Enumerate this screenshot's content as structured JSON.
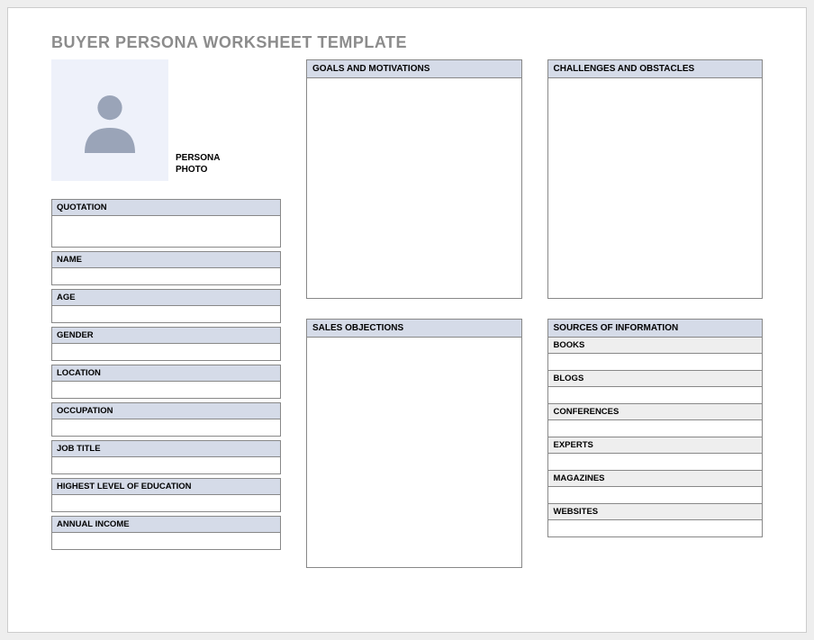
{
  "title": "BUYER PERSONA WORKSHEET TEMPLATE",
  "photo_label": "PERSONA PHOTO",
  "left_fields": [
    {
      "label": "QUOTATION",
      "value": ""
    },
    {
      "label": "NAME",
      "value": ""
    },
    {
      "label": "AGE",
      "value": ""
    },
    {
      "label": "GENDER",
      "value": ""
    },
    {
      "label": "LOCATION",
      "value": ""
    },
    {
      "label": "OCCUPATION",
      "value": ""
    },
    {
      "label": "JOB TITLE",
      "value": ""
    },
    {
      "label": "HIGHEST LEVEL OF EDUCATION",
      "value": ""
    },
    {
      "label": "ANNUAL INCOME",
      "value": ""
    }
  ],
  "panels": {
    "goals": {
      "label": "GOALS AND MOTIVATIONS",
      "value": ""
    },
    "challenges": {
      "label": "CHALLENGES AND OBSTACLES",
      "value": ""
    },
    "objections": {
      "label": "SALES OBJECTIONS",
      "value": ""
    },
    "sources": {
      "label": "SOURCES OF INFORMATION",
      "items": [
        {
          "label": "BOOKS",
          "value": ""
        },
        {
          "label": "BLOGS",
          "value": ""
        },
        {
          "label": "CONFERENCES",
          "value": ""
        },
        {
          "label": "EXPERTS",
          "value": ""
        },
        {
          "label": "MAGAZINES",
          "value": ""
        },
        {
          "label": "WEBSITES",
          "value": ""
        }
      ]
    }
  }
}
